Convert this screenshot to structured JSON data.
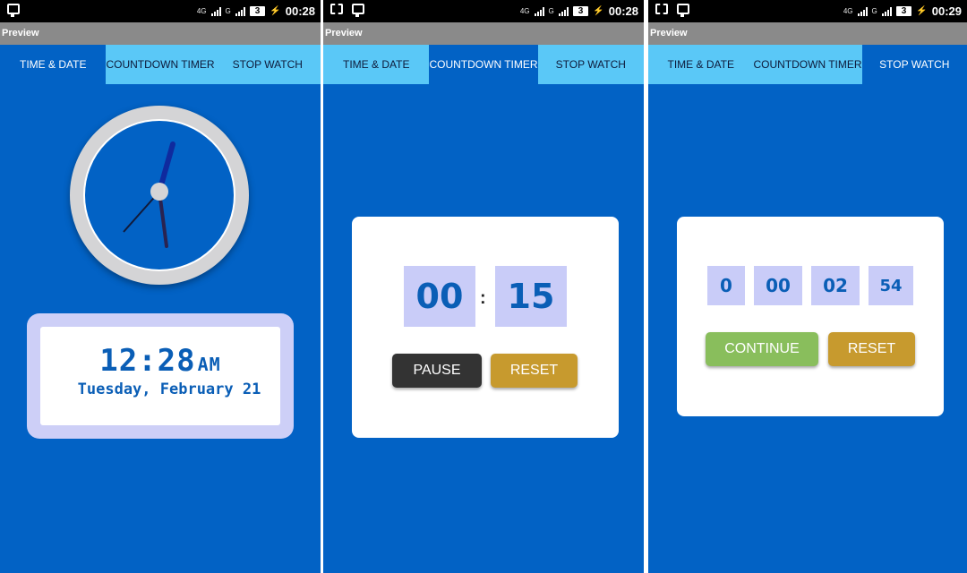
{
  "panels": [
    {
      "status": {
        "network": "4G",
        "signal_label": "G",
        "battery": "3",
        "time": "00:28"
      },
      "preview_label": "Preview",
      "tabs": [
        "TIME & DATE",
        "COUNTDOWN TIMER",
        "STOP WATCH"
      ],
      "active_tab": 0,
      "time_date": {
        "time": "12:28",
        "ampm": "AM",
        "date": "Tuesday, February 21"
      }
    },
    {
      "status": {
        "network": "4G",
        "signal_label": "G",
        "battery": "3",
        "time": "00:28"
      },
      "preview_label": "Preview",
      "tabs": [
        "TIME & DATE",
        "COUNTDOWN TIMER",
        "STOP WATCH"
      ],
      "active_tab": 1,
      "countdown": {
        "minutes": "00",
        "separator": ":",
        "seconds": "15",
        "pause_label": "PAUSE",
        "reset_label": "RESET"
      }
    },
    {
      "status": {
        "network": "4G",
        "signal_label": "G",
        "battery": "3",
        "time": "00:29"
      },
      "preview_label": "Preview",
      "tabs": [
        "TIME & DATE",
        "COUNTDOWN TIMER",
        "STOP WATCH"
      ],
      "active_tab": 2,
      "stopwatch": {
        "hours": "0",
        "minutes": "00",
        "seconds": "02",
        "millis": "54",
        "continue_label": "CONTINUE",
        "reset_label": "RESET"
      }
    }
  ],
  "colors": {
    "background": "#0262c5",
    "tab_bar": "#5ac8f7",
    "digit_box": "#c9ccf8",
    "pause": "#333333",
    "reset": "#c79a2e",
    "continue": "#89be5c",
    "clock_face": "#0262c5"
  },
  "icons": [
    "chat-icon",
    "screenshot-icon",
    "signal-icon",
    "battery-icon",
    "charging-icon"
  ]
}
